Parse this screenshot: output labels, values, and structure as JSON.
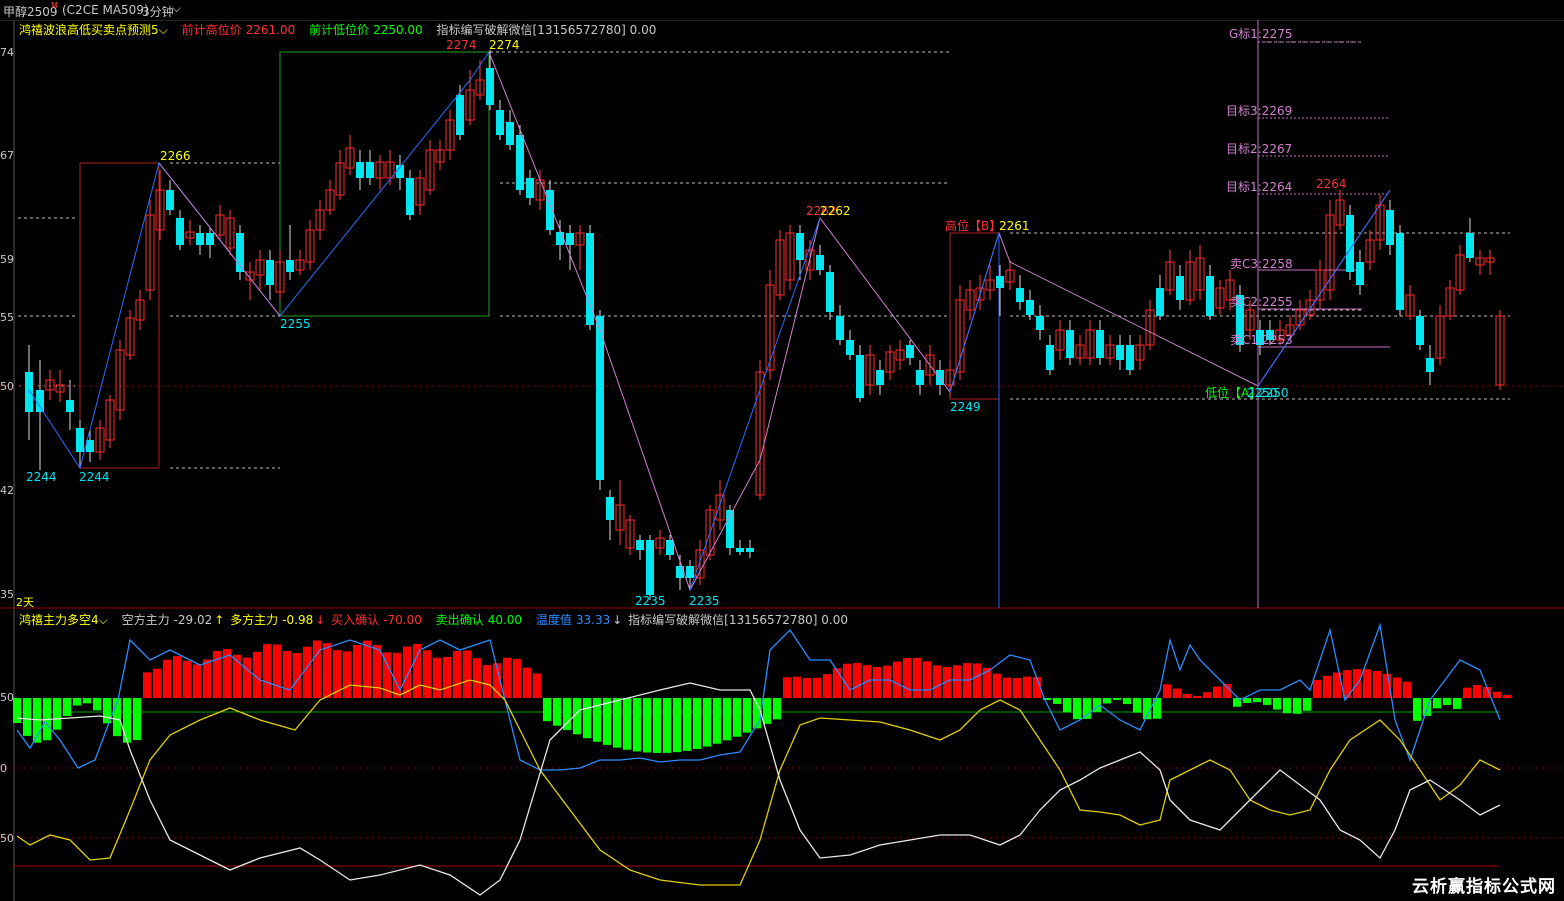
{
  "topbar": {
    "symbol": "甲醇2509",
    "symbol_mark": "M",
    "contract": "(C2CE MA509)",
    "period": "3分钟",
    "period_chevron": "⌵"
  },
  "main_header": {
    "indicator": "鸿禧波浪高低买卖点预测5",
    "prev_high_label": "前计高位价",
    "prev_high_value": "2261.00",
    "prev_low_label": "前计低位价",
    "prev_low_value": "2250.00",
    "note": "指标编写破解微信[13156572780] 0.00"
  },
  "price_axis": [
    "74",
    "67",
    "59",
    "55",
    "50",
    "42",
    "35"
  ],
  "days_label": "2天",
  "price_labels": {
    "p2274a": "2274",
    "p2274b": "2274",
    "p2266": "2266",
    "p2255": "2255",
    "p2244a": "2244",
    "p2244b": "2244",
    "p2235a": "2235",
    "p2235b": "2235",
    "p2262a": "2262",
    "p2262b": "2262",
    "p2249": "2249",
    "p2264": "2264",
    "high_b": "高位【B】",
    "high_b_val": "2261",
    "low_a": "低位【A】",
    "low_a_val": "2250",
    "low_a_val2": "2250",
    "g_target": "G标1:2275",
    "target3": "目标3:2269",
    "target2": "目标2:2267",
    "target1": "目标1:2264",
    "sell_c3": "卖C3:2258",
    "sell_c2": "卖C2:2255",
    "sell_c1": "卖C1:2253"
  },
  "sub_header": {
    "indicator": "鸿禧主力多空4",
    "short_label": "空方主力",
    "short_value": "-29.02",
    "long_label": "多方主力",
    "long_value": "-0.98",
    "buy_label": "买入确认",
    "buy_value": "-70.00",
    "sell_label": "卖出确认",
    "sell_value": "40.00",
    "temp_label": "温度值",
    "temp_value": "33.33",
    "note": "指标编写破解微信[13156572780] 0.00"
  },
  "sub_axis": [
    "50",
    "0",
    "50"
  ],
  "watermark": "云析赢指标公式网",
  "colors": {
    "up": "#ff2a2a",
    "down": "#00e5ee",
    "green_bar": "#00ff00",
    "red_bar": "#ff0000",
    "yellow": "#ffff00",
    "blue": "#2a8cff",
    "pink": "#d080d0"
  }
}
